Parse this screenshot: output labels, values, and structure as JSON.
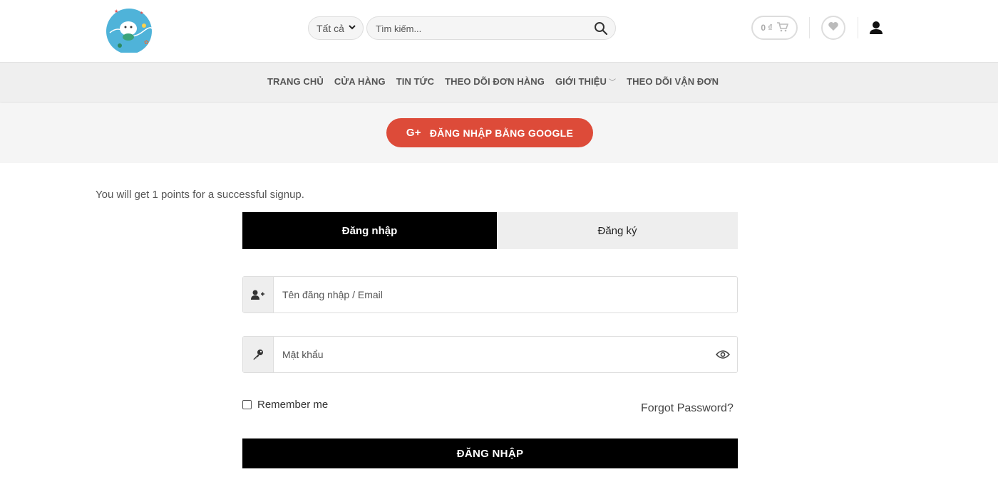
{
  "header": {
    "category_select": {
      "value": "Tất cả"
    },
    "search": {
      "placeholder": "Tìm kiếm..."
    },
    "cart": {
      "amount": "0 ₫"
    }
  },
  "nav": {
    "items": [
      {
        "label": "TRANG CHỦ"
      },
      {
        "label": "CỬA HÀNG"
      },
      {
        "label": "TIN TỨC"
      },
      {
        "label": "THEO DÕI ĐƠN HÀNG"
      },
      {
        "label": "GIỚI THIỆU",
        "has_dropdown": true
      },
      {
        "label": "THEO DÕI VẬN ĐƠN"
      }
    ]
  },
  "social_login": {
    "google_label": "ĐĂNG NHẬP BẰNG GOOGLE",
    "icon": "G+"
  },
  "content": {
    "signup_note": "You will get 1 points for a successful signup.",
    "tabs": [
      {
        "label": "Đăng nhập",
        "active": true
      },
      {
        "label": "Đăng ký",
        "active": false
      }
    ],
    "username_field": {
      "placeholder": "Tên đăng nhập / Email"
    },
    "password_field": {
      "placeholder": "Mật khẩu"
    },
    "remember_label": "Remember me",
    "forgot_label": "Forgot Password?",
    "login_button": "ĐĂNG NHẬP"
  },
  "colors": {
    "google_red": "#dd4b39",
    "primary_black": "#000000",
    "nav_bg": "#efefef"
  }
}
